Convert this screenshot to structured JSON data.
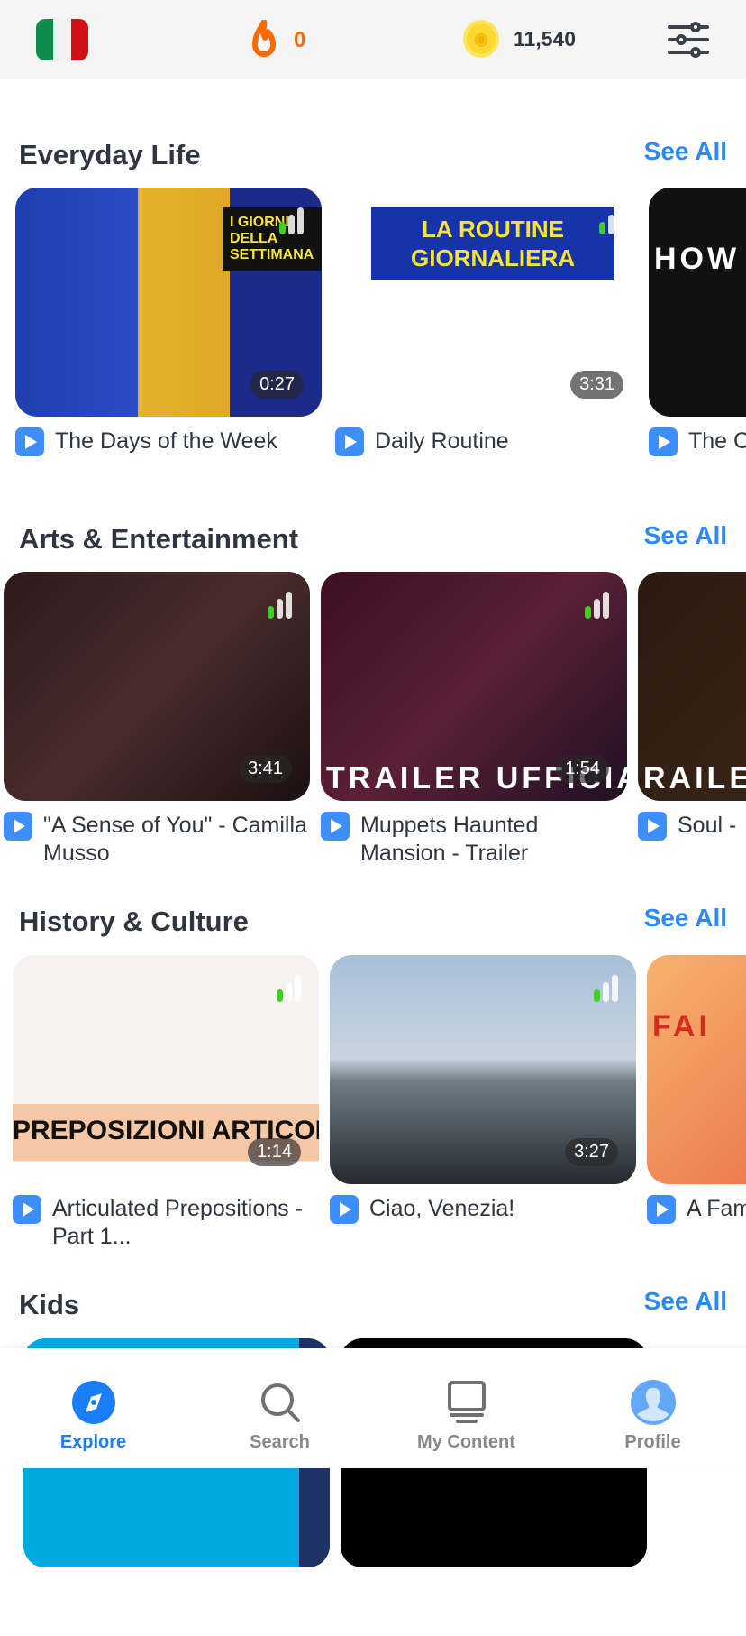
{
  "header": {
    "flag": "italy-flag",
    "streak": "0",
    "coins": "11,540",
    "colors": {
      "streak": "#ff6a00",
      "coin": "#fdd835"
    }
  },
  "sections": [
    {
      "title": "Everyday Life",
      "see_all": "See All",
      "cards": [
        {
          "title": "The Days of the Week",
          "duration": "0:27",
          "level": 1,
          "thumb_text": "I GIORNI DELLA SETTIMANA"
        },
        {
          "title": "Daily Routine",
          "duration": "3:31",
          "level": 1,
          "thumb_text": "LA ROUTINE GIORNALIERA"
        },
        {
          "title": "The C",
          "duration": "",
          "level": 0,
          "thumb_text": "HOW I IN"
        }
      ]
    },
    {
      "title": "Arts & Entertainment",
      "see_all": "See All",
      "cards": [
        {
          "title": "\"A Sense of You\" - Camilla Musso",
          "duration": "3:41",
          "level": 1,
          "thumb_text": ""
        },
        {
          "title": "Muppets Haunted Mansion - Trailer",
          "duration": "1:54",
          "level": 1,
          "thumb_text": "TRAILER UFFICIALE"
        },
        {
          "title": "Soul -",
          "duration": "",
          "level": 0,
          "thumb_text": "RAILER"
        }
      ]
    },
    {
      "title": "History & Culture",
      "see_all": "See All",
      "cards": [
        {
          "title": "Articulated Prepositions - Part 1...",
          "duration": "1:14",
          "level": 1,
          "thumb_text": "PREPOSIZIONI ARTICOLATE"
        },
        {
          "title": "Ciao, Venezia!",
          "duration": "3:27",
          "level": 1,
          "thumb_text": ""
        },
        {
          "title": "A Fam",
          "duration": "",
          "level": 0,
          "thumb_text": "FAI"
        }
      ]
    },
    {
      "title": "Kids",
      "see_all": "See All",
      "cards": []
    }
  ],
  "nav": [
    {
      "label": "Explore",
      "icon": "compass-icon",
      "active": true
    },
    {
      "label": "Search",
      "icon": "search-icon"
    },
    {
      "label": "My Content",
      "icon": "my-content-icon"
    },
    {
      "label": "Profile",
      "icon": "profile-avatar-icon"
    }
  ],
  "accent": "#2b8af7"
}
